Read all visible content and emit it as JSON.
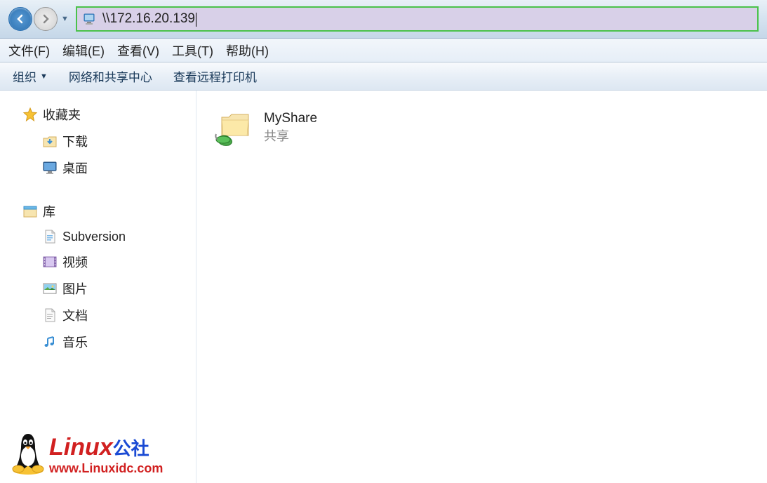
{
  "nav": {
    "address": "\\\\172.16.20.139"
  },
  "menu": {
    "file": "文件(F)",
    "edit": "编辑(E)",
    "view": "查看(V)",
    "tools": "工具(T)",
    "help": "帮助(H)"
  },
  "toolbar": {
    "organize": "组织",
    "network_center": "网络和共享中心",
    "view_printers": "查看远程打印机"
  },
  "sidebar": {
    "favorites": {
      "label": "收藏夹",
      "children": {
        "downloads": "下载",
        "desktop": "桌面"
      }
    },
    "libraries": {
      "label": "库",
      "children": {
        "subversion": "Subversion",
        "videos": "视频",
        "pictures": "图片",
        "documents": "文档",
        "music": "音乐"
      }
    }
  },
  "main": {
    "folder": {
      "name": "MyShare",
      "desc": "共享"
    }
  },
  "watermark": {
    "title_part1": "Linux",
    "title_part2": "公社",
    "url": "www.Linuxidc.com"
  }
}
